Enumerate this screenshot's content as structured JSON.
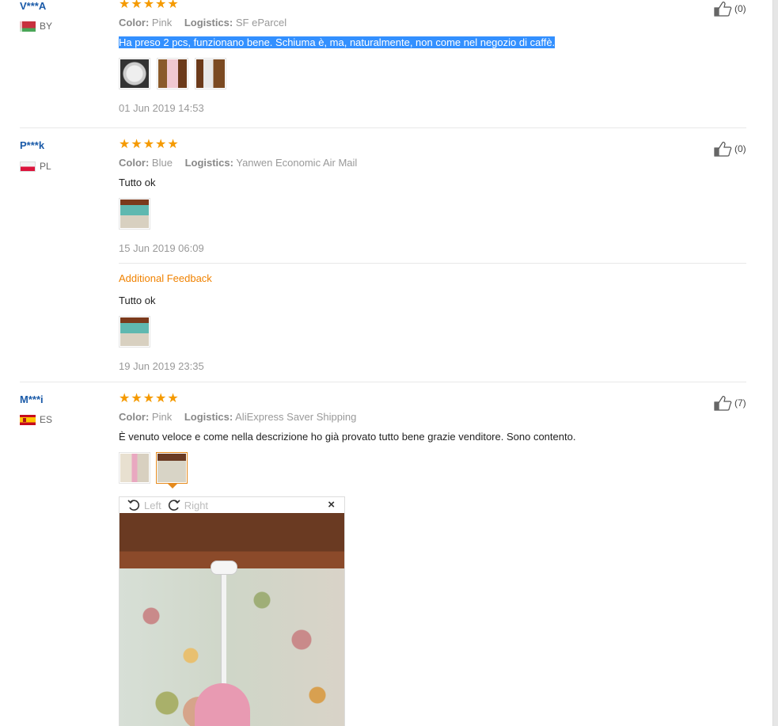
{
  "labels": {
    "color": "Color:",
    "logistics": "Logistics:"
  },
  "stars": "★★★★★",
  "reviews": [
    {
      "user": "V***A",
      "country": "BY",
      "color": "Pink",
      "logistics": "SF eParcel",
      "text": "Ha preso 2 pcs, funzionano bene. Schiuma è, ma, naturalmente, non come nel negozio di caffè.",
      "date": "01 Jun 2019 14:53",
      "likes": "(0)"
    },
    {
      "user": "P***k",
      "country": "PL",
      "color": "Blue",
      "logistics": "Yanwen Economic Air Mail",
      "text": "Tutto ok",
      "date": "15 Jun 2019 06:09",
      "likes": "(0)",
      "additional": {
        "heading": "Additional Feedback",
        "text": "Tutto ok",
        "date": "19 Jun 2019 23:35"
      }
    },
    {
      "user": "M***i",
      "country": "ES",
      "color": "Pink",
      "logistics": "AliExpress Saver Shipping",
      "text": "È venuto veloce e come nella descrizione ho già provato tutto bene grazie venditore. Sono contento.",
      "likes": "(7)"
    }
  ],
  "viewer": {
    "left_label": "Left",
    "right_label": "Right",
    "close": "×"
  },
  "colors": {
    "star": "#f59a00",
    "username": "#1a5aa8",
    "additional": "#f08200",
    "selection": "#3390ff"
  }
}
